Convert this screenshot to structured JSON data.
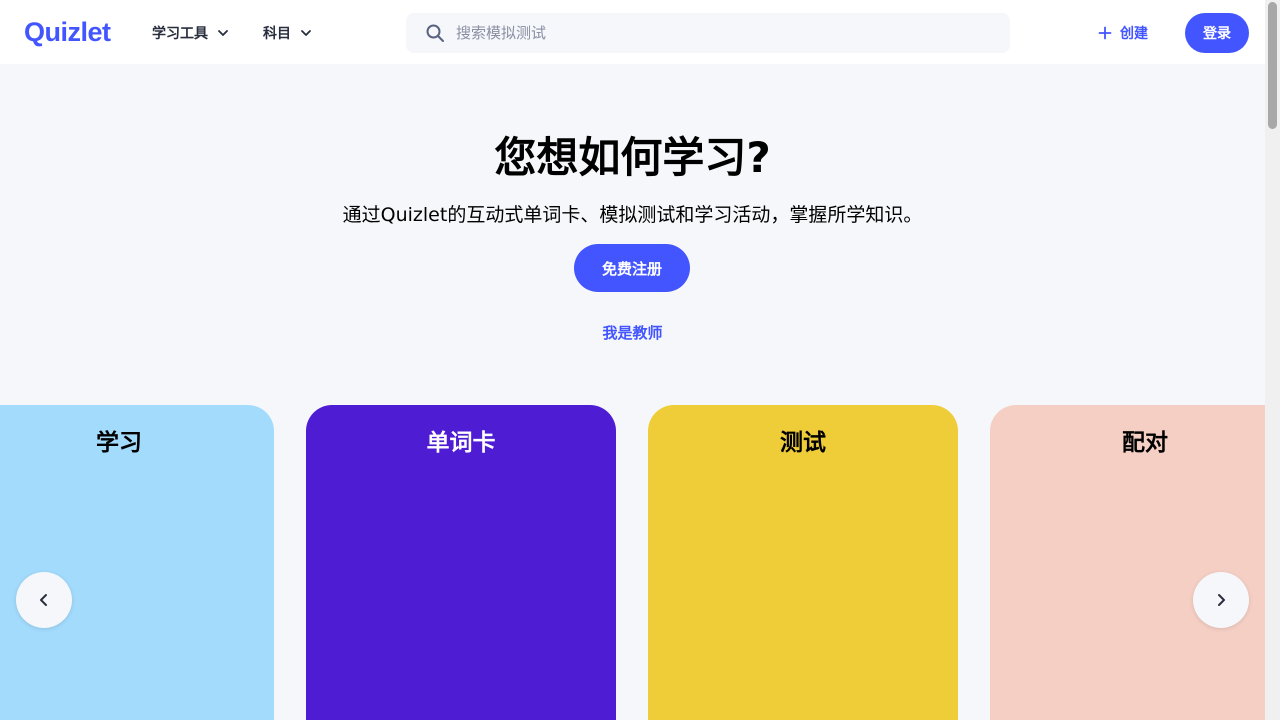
{
  "header": {
    "logo": "Quizlet",
    "nav": [
      {
        "label": "学习工具"
      },
      {
        "label": "科目"
      }
    ],
    "search_placeholder": "搜索模拟测试",
    "create_label": "创建",
    "login_label": "登录"
  },
  "hero": {
    "title": "您想如何学习?",
    "subtitle": "通过Quizlet的互动式单词卡、模拟测试和学习活动，掌握所学知识。",
    "signup_label": "免费注册",
    "teacher_label": "我是教师"
  },
  "cards": [
    {
      "label": "学习",
      "color": "#a3dbfd"
    },
    {
      "label": "单词卡",
      "color": "#4e1cd3"
    },
    {
      "label": "测试",
      "color": "#efcd39"
    },
    {
      "label": "配对",
      "color": "#f5cfc4"
    }
  ],
  "colors": {
    "brand": "#4255ff",
    "background": "#f6f7fb"
  },
  "icons": {
    "search": "search-icon",
    "chevron": "chevron-down-icon",
    "plus": "plus-icon",
    "prev": "chevron-left-icon",
    "next": "chevron-right-icon"
  }
}
